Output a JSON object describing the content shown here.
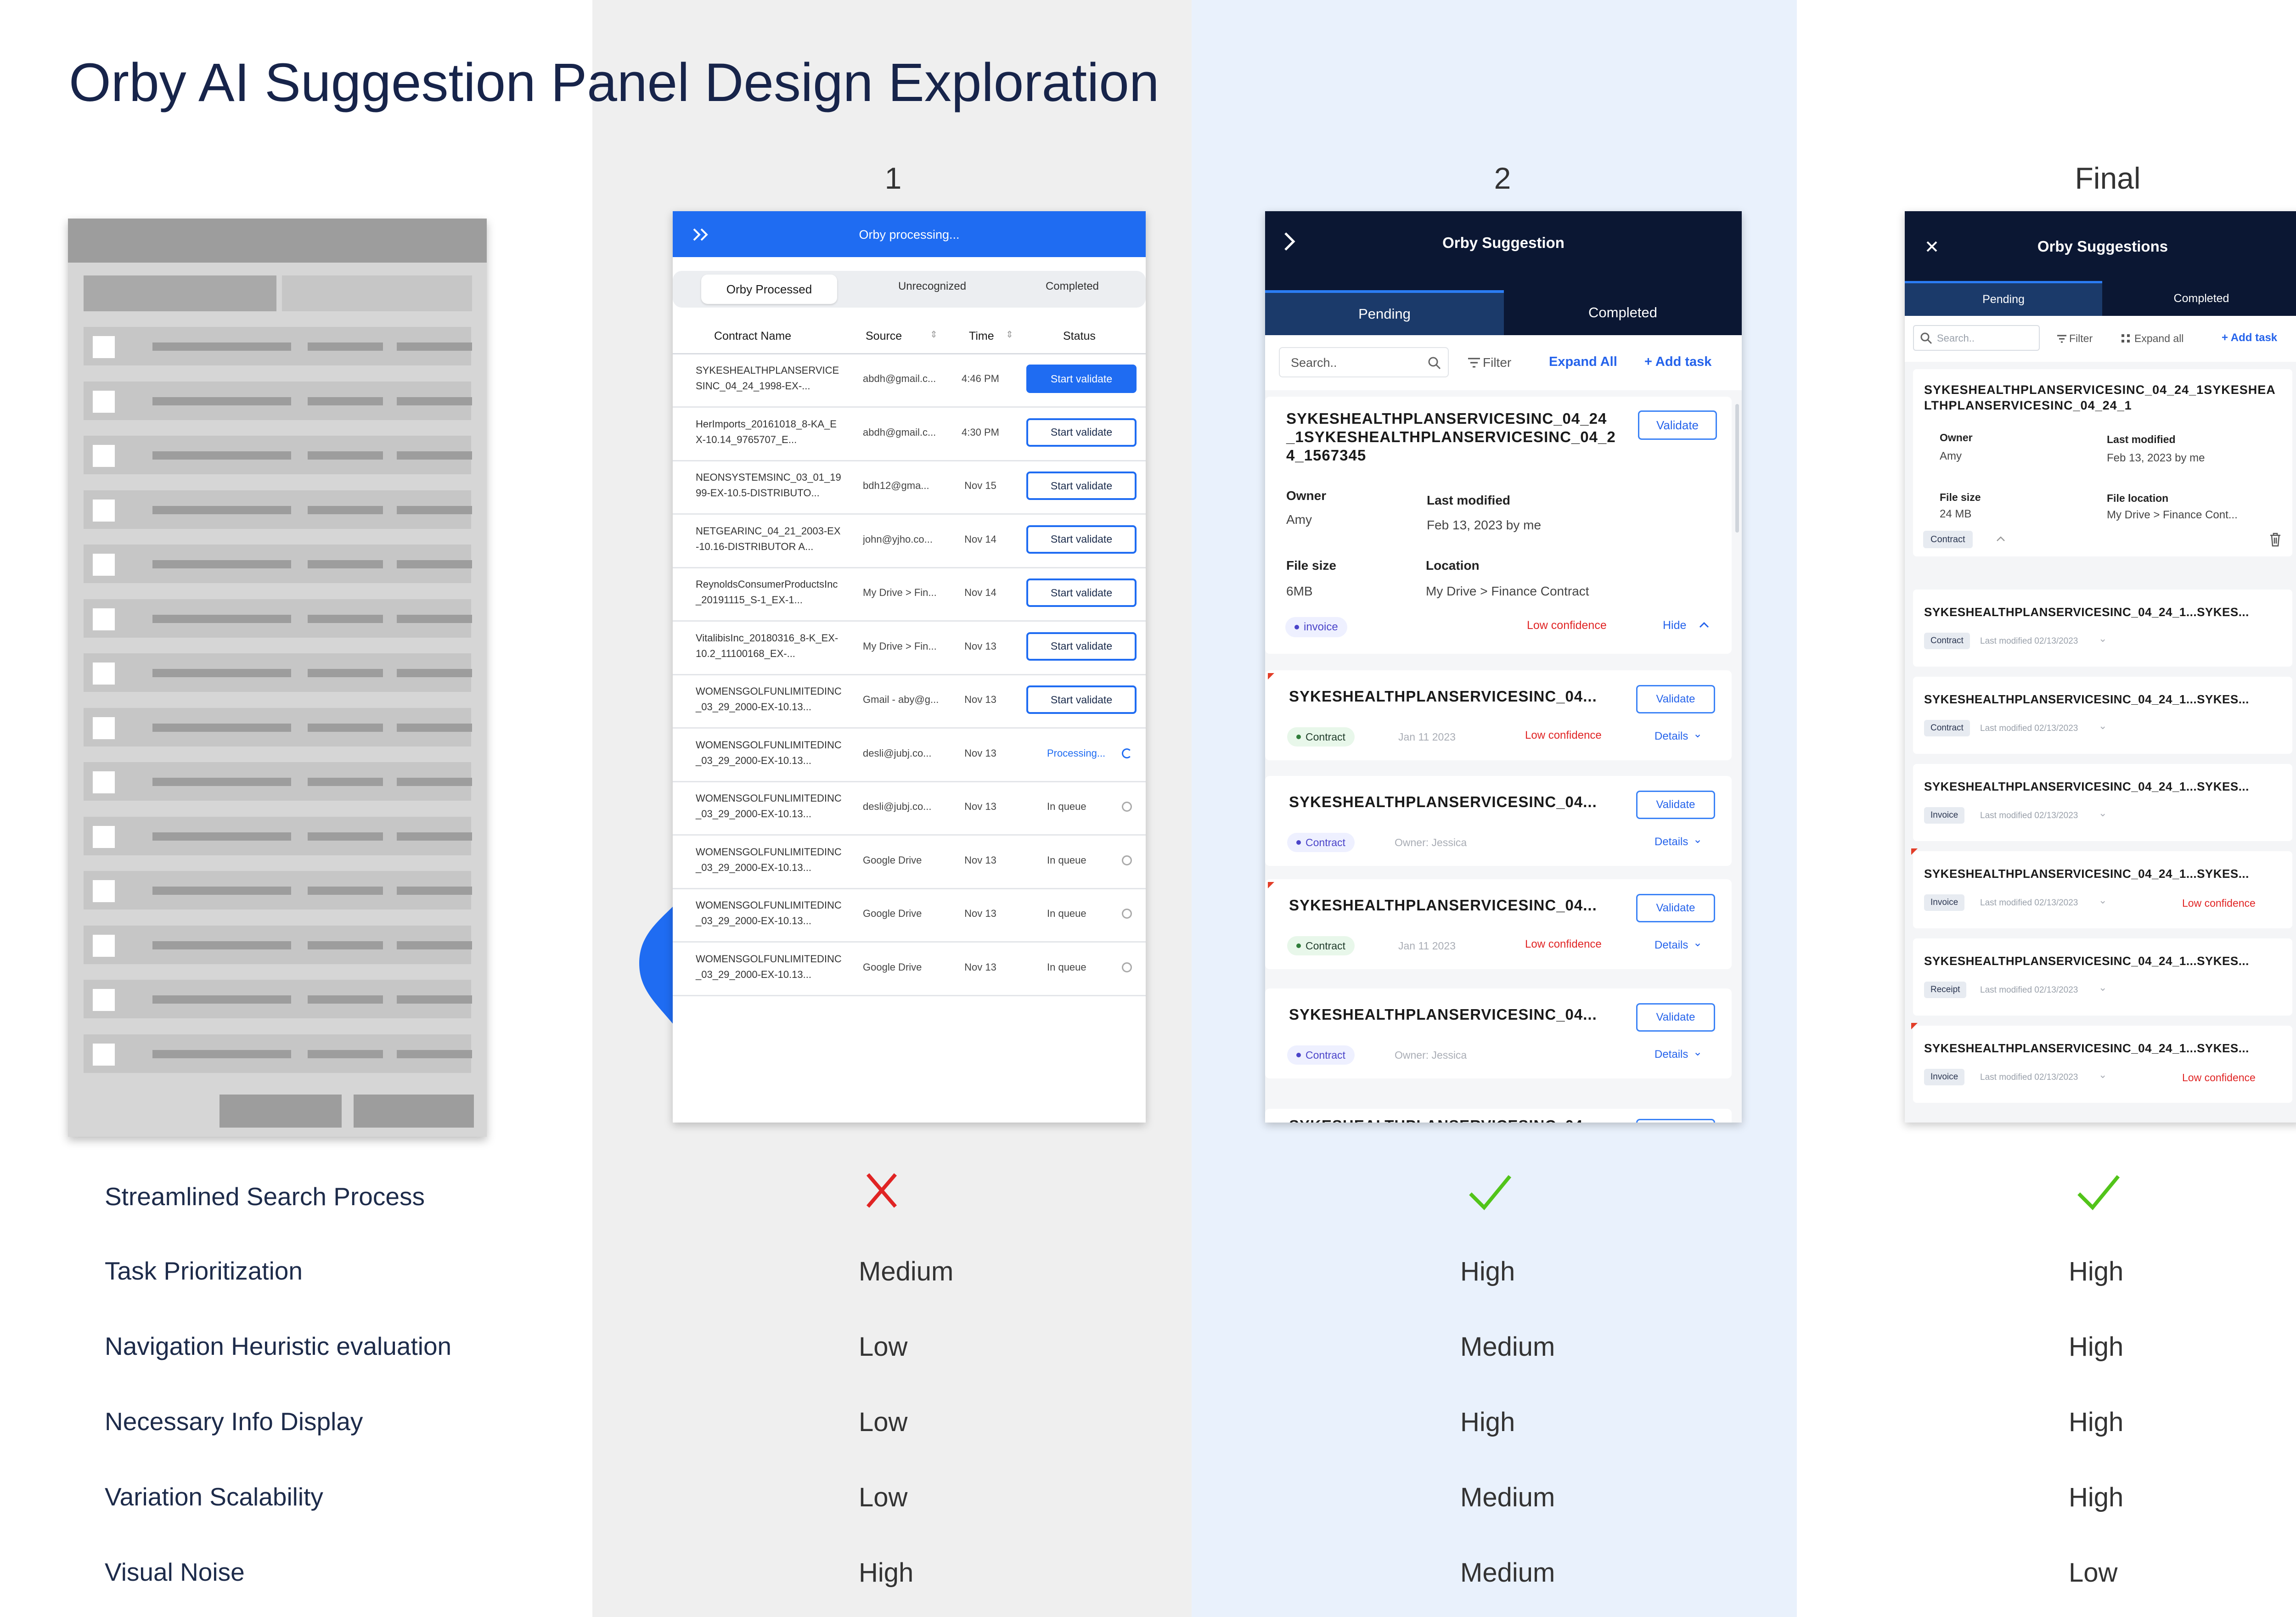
{
  "page_title": "Orby AI Suggestion Panel Design Exploration",
  "columns": {
    "col1": "1",
    "col2": "2",
    "col3": "Final"
  },
  "panel1": {
    "header_title": "Orby processing...",
    "tabs": [
      "Orby Processed",
      "Unrecognized",
      "Completed"
    ],
    "columns": [
      "Contract Name",
      "Source",
      "Time",
      "Status"
    ],
    "rows": [
      {
        "name": "SYKESHEALTHPLANSERVICESINC_04_24_1998-EX-...",
        "source": "abdh@gmail.c...",
        "time": "4:46 PM",
        "status": "Start validate",
        "style": "solid"
      },
      {
        "name": "HerImports_20161018_8-KA_EX-10.14_9765707_E...",
        "source": "abdh@gmail.c...",
        "time": "4:30 PM",
        "status": "Start validate",
        "style": "outline"
      },
      {
        "name": "NEONSYSTEMSINC_03_01_1999-EX-10.5-DISTRIBUTO...",
        "source": "bdh12@gma...",
        "time": "Nov 15",
        "status": "Start validate",
        "style": "outline"
      },
      {
        "name": "NETGEARINC_04_21_2003-EX-10.16-DISTRIBUTOR A...",
        "source": "john@yjho.co...",
        "time": "Nov 14",
        "status": "Start validate",
        "style": "outline"
      },
      {
        "name": "ReynoldsConsumerProductsInc_20191115_S-1_EX-1...",
        "source": "My Drive > Fin...",
        "time": "Nov 14",
        "status": "Start validate",
        "style": "outline"
      },
      {
        "name": "VitalibisInc_20180316_8-K_EX-10.2_11100168_EX-...",
        "source": "My Drive > Fin...",
        "time": "Nov 13",
        "status": "Start validate",
        "style": "outline"
      },
      {
        "name": "WOMENSGOLFUNLIMITEDINC_03_29_2000-EX-10.13...",
        "source": "Gmail - aby@g...",
        "time": "Nov 13",
        "status": "Start validate",
        "style": "outline"
      },
      {
        "name": "WOMENSGOLFUNLIMITEDINC_03_29_2000-EX-10.13...",
        "source": "desli@jubj.co...",
        "time": "Nov 13",
        "status": "Processing...",
        "style": "processing"
      },
      {
        "name": "WOMENSGOLFUNLIMITEDINC_03_29_2000-EX-10.13...",
        "source": "desli@jubj.co...",
        "time": "Nov 13",
        "status": "In queue",
        "style": "queue"
      },
      {
        "name": "WOMENSGOLFUNLIMITEDINC_03_29_2000-EX-10.13...",
        "source": "Google Drive",
        "time": "Nov 13",
        "status": "In queue",
        "style": "queue"
      },
      {
        "name": "WOMENSGOLFUNLIMITEDINC_03_29_2000-EX-10.13...",
        "source": "Google Drive",
        "time": "Nov 13",
        "status": "In queue",
        "style": "queue"
      },
      {
        "name": "WOMENSGOLFUNLIMITEDINC_03_29_2000-EX-10.13...",
        "source": "Google Drive",
        "time": "Nov 13",
        "status": "In queue",
        "style": "queue"
      }
    ]
  },
  "panel2": {
    "title": "Orby Suggestion",
    "tab_pending": "Pending",
    "tab_completed": "Completed",
    "search_placeholder": "Search..",
    "filter": "Filter",
    "expand_all": "Expand All",
    "add_task": "+ Add task",
    "expanded_card": {
      "title_lines": [
        "SYKESHEALTHPLANSERVICESINC_04_24",
        "_1SYKESHEALTHPLANSERVICESINC_04_2",
        "4_1567345"
      ],
      "validate": "Validate",
      "owner_label": "Owner",
      "owner": "Amy",
      "modified_label": "Last modified",
      "modified": "Feb 13, 2023 by me",
      "size_label": "File size",
      "size": "6MB",
      "location_label": "Location",
      "location": "My Drive > Finance Contract",
      "chip": "invoice",
      "confidence": "Low confidence",
      "hide": "Hide"
    },
    "cards": [
      {
        "title": "SYKESHEALTHPLANSERVICESINC_04...",
        "chip": "Contract",
        "chip_color": "green",
        "meta": "Jan 11 2023",
        "confidence": "Low confidence",
        "flag": true
      },
      {
        "title": "SYKESHEALTHPLANSERVICESINC_04...",
        "chip": "Contract",
        "chip_color": "purple",
        "meta": "Owner: Jessica",
        "confidence": "",
        "flag": false
      },
      {
        "title": "SYKESHEALTHPLANSERVICESINC_04...",
        "chip": "Contract",
        "chip_color": "green",
        "meta": "Jan 11 2023",
        "confidence": "Low confidence",
        "flag": true
      },
      {
        "title": "SYKESHEALTHPLANSERVICESINC_04...",
        "chip": "Contract",
        "chip_color": "purple",
        "meta": "Owner: Jessica",
        "confidence": "",
        "flag": false
      }
    ],
    "validate": "Validate",
    "details": "Details",
    "partial_title": "SYKESHEALTHPLANSERVICESINC_04..."
  },
  "panel3": {
    "title": "Orby Suggestions",
    "tab_pending": "Pending",
    "tab_completed": "Completed",
    "search_placeholder": "Search..",
    "filter": "Filter",
    "expand_all": "Expand all",
    "add_task": "+ Add task",
    "expanded_card": {
      "title_lines": [
        "SYKESHEALTHPLANSERVICESINC_04_24_1SYKESHEA",
        "LTHPLANSERVICESINC_04_24_1"
      ],
      "owner_label": "Owner",
      "owner": "Amy",
      "modified_label": "Last modified",
      "modified": "Feb 13, 2023 by me",
      "size_label": "File size",
      "size": "24 MB",
      "location_label": "File location",
      "location": "My Drive > Finance Cont...",
      "chip": "Contract"
    },
    "cards": [
      {
        "title": "SYKESHEALTHPLANSERVICESINC_04_24_1...SYKES...",
        "chip": "Contract",
        "modified": "Last modified 02/13/2023",
        "confidence": "",
        "flag": false
      },
      {
        "title": "SYKESHEALTHPLANSERVICESINC_04_24_1...SYKES...",
        "chip": "Contract",
        "modified": "Last modified 02/13/2023",
        "confidence": "",
        "flag": false
      },
      {
        "title": "SYKESHEALTHPLANSERVICESINC_04_24_1...SYKES...",
        "chip": "Invoice",
        "modified": "Last modified 02/13/2023",
        "confidence": "",
        "flag": false
      },
      {
        "title": "SYKESHEALTHPLANSERVICESINC_04_24_1...SYKES...",
        "chip": "Invoice",
        "modified": "Last modified 02/13/2023",
        "confidence": "Low confidence",
        "flag": true
      },
      {
        "title": "SYKESHEALTHPLANSERVICESINC_04_24_1...SYKES...",
        "chip": "Receipt",
        "modified": "Last modified 02/13/2023",
        "confidence": "",
        "flag": false
      },
      {
        "title": "SYKESHEALTHPLANSERVICESINC_04_24_1...SYKES...",
        "chip": "Invoice",
        "modified": "Last modified 02/13/2023",
        "confidence": "Low confidence",
        "flag": true
      }
    ]
  },
  "comparison": {
    "rows": [
      {
        "label": "Streamlined Search Process",
        "v1": "cross",
        "v2": "check",
        "v3": "check"
      },
      {
        "label": "Task Prioritization",
        "v1": "Medium",
        "v2": "High",
        "v3": "High"
      },
      {
        "label": "Navigation Heuristic evaluation",
        "v1": "Low",
        "v2": "Medium",
        "v3": "High"
      },
      {
        "label": "Necessary Info Display",
        "v1": "Low",
        "v2": "High",
        "v3": "High"
      },
      {
        "label": "Variation Scalability",
        "v1": "Low",
        "v2": "Medium",
        "v3": "High"
      },
      {
        "label": "Visual Noise",
        "v1": "High",
        "v2": "Medium",
        "v3": "Low"
      }
    ]
  },
  "colors": {
    "accent": "#1f6cf2",
    "dark_header": "#0b1733",
    "check": "#52c41a",
    "cross": "#e02424",
    "low_confidence": "#e02424"
  }
}
